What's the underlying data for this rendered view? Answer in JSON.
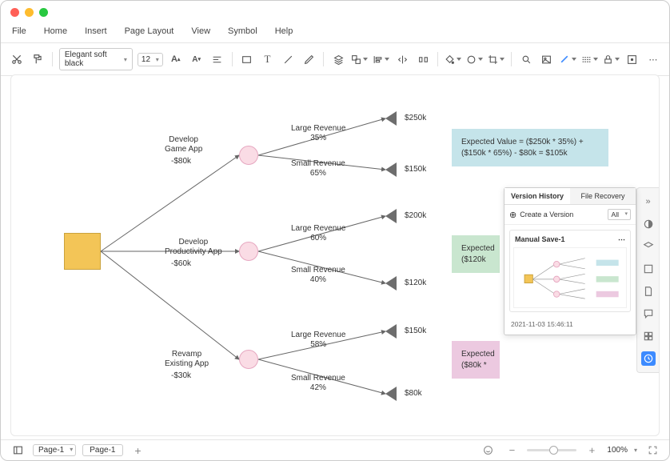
{
  "menu": {
    "file": "File",
    "home": "Home",
    "insert": "Insert",
    "page_layout": "Page Layout",
    "view": "View",
    "symbol": "Symbol",
    "help": "Help"
  },
  "toolbar": {
    "font_name": "Elegant soft black",
    "font_size": "12"
  },
  "tree": {
    "branches": [
      {
        "name_l1": "Develop",
        "name_l2": "Game App",
        "cost": "-$80k",
        "large_label": "Large Revenue",
        "large_pct": "35%",
        "large_val": "$250k",
        "small_label": "Small Revenue",
        "small_pct": "65%",
        "small_val": "$150k"
      },
      {
        "name_l1": "Develop",
        "name_l2": "Productivity App",
        "cost": "-$60k",
        "large_label": "Large Revenue",
        "large_pct": "60%",
        "large_val": "$200k",
        "small_label": "Small Revenue",
        "small_pct": "40%",
        "small_val": "$120k"
      },
      {
        "name_l1": "Revamp",
        "name_l2": "Existing App",
        "cost": "-$30k",
        "large_label": "Large Revenue",
        "large_pct": "58%",
        "large_val": "$150k",
        "small_label": "Small Revenue",
        "small_pct": "42%",
        "small_val": "$80k"
      }
    ]
  },
  "notes": {
    "blue_l1": "Expected Value = ($250k * 35%) +",
    "blue_l2": "($150k * 65%) - $80k = $105k",
    "green_l1": "Expected",
    "green_l2": "($120k",
    "pink_l1": "Expected",
    "pink_l2": "($80k *"
  },
  "panel": {
    "tab_history": "Version History",
    "tab_recovery": "File Recovery",
    "create": "Create a Version",
    "filter": "All",
    "save_name": "Manual Save-1",
    "timestamp": "2021-11-03 15:46:11"
  },
  "status": {
    "page_sel": "Page-1",
    "page_tab": "Page-1",
    "zoom": "100%"
  }
}
